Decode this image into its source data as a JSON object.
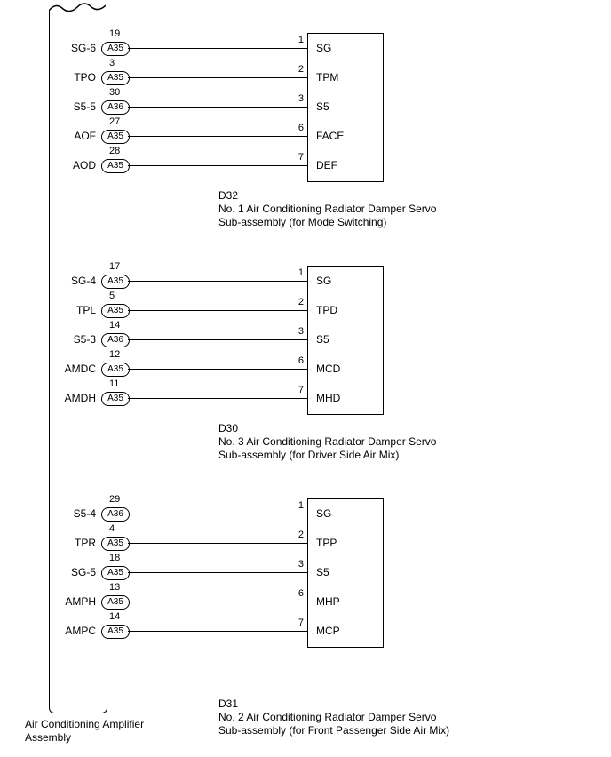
{
  "source": {
    "label_line1": "Air Conditioning Amplifier",
    "label_line2": "Assembly"
  },
  "groups": [
    {
      "id": "g1",
      "desc_id": "D32",
      "desc_line1": "No. 1 Air Conditioning Radiator Damper Servo",
      "desc_line2": "Sub-assembly (for Mode Switching)",
      "rows": [
        {
          "left_label": "SG-6",
          "conn_pin": "19",
          "conn": "A35",
          "right_pin": "1",
          "right_label": "SG"
        },
        {
          "left_label": "TPO",
          "conn_pin": "3",
          "conn": "A35",
          "right_pin": "2",
          "right_label": "TPM"
        },
        {
          "left_label": "S5-5",
          "conn_pin": "30",
          "conn": "A36",
          "right_pin": "3",
          "right_label": "S5"
        },
        {
          "left_label": "AOF",
          "conn_pin": "27",
          "conn": "A35",
          "right_pin": "6",
          "right_label": "FACE"
        },
        {
          "left_label": "AOD",
          "conn_pin": "28",
          "conn": "A35",
          "right_pin": "7",
          "right_label": "DEF"
        }
      ]
    },
    {
      "id": "g2",
      "desc_id": "D30",
      "desc_line1": "No. 3 Air Conditioning Radiator Damper Servo",
      "desc_line2": "Sub-assembly (for Driver Side Air Mix)",
      "rows": [
        {
          "left_label": "SG-4",
          "conn_pin": "17",
          "conn": "A35",
          "right_pin": "1",
          "right_label": "SG"
        },
        {
          "left_label": "TPL",
          "conn_pin": "5",
          "conn": "A35",
          "right_pin": "2",
          "right_label": "TPD"
        },
        {
          "left_label": "S5-3",
          "conn_pin": "14",
          "conn": "A36",
          "right_pin": "3",
          "right_label": "S5"
        },
        {
          "left_label": "AMDC",
          "conn_pin": "12",
          "conn": "A35",
          "right_pin": "6",
          "right_label": "MCD"
        },
        {
          "left_label": "AMDH",
          "conn_pin": "11",
          "conn": "A35",
          "right_pin": "7",
          "right_label": "MHD"
        }
      ]
    },
    {
      "id": "g3",
      "desc_id": "D31",
      "desc_line1": "No. 2 Air Conditioning Radiator Damper Servo",
      "desc_line2": "Sub-assembly (for Front Passenger Side Air Mix)",
      "rows": [
        {
          "left_label": "S5-4",
          "conn_pin": "29",
          "conn": "A36",
          "right_pin": "1",
          "right_label": "SG"
        },
        {
          "left_label": "TPR",
          "conn_pin": "4",
          "conn": "A35",
          "right_pin": "2",
          "right_label": "TPP"
        },
        {
          "left_label": "SG-5",
          "conn_pin": "18",
          "conn": "A35",
          "right_pin": "3",
          "right_label": "S5"
        },
        {
          "left_label": "AMPH",
          "conn_pin": "13",
          "conn": "A35",
          "right_pin": "6",
          "right_label": "MHP"
        },
        {
          "left_label": "AMPC",
          "conn_pin": "14",
          "conn": "A35",
          "right_pin": "7",
          "right_label": "MCP"
        }
      ]
    }
  ]
}
